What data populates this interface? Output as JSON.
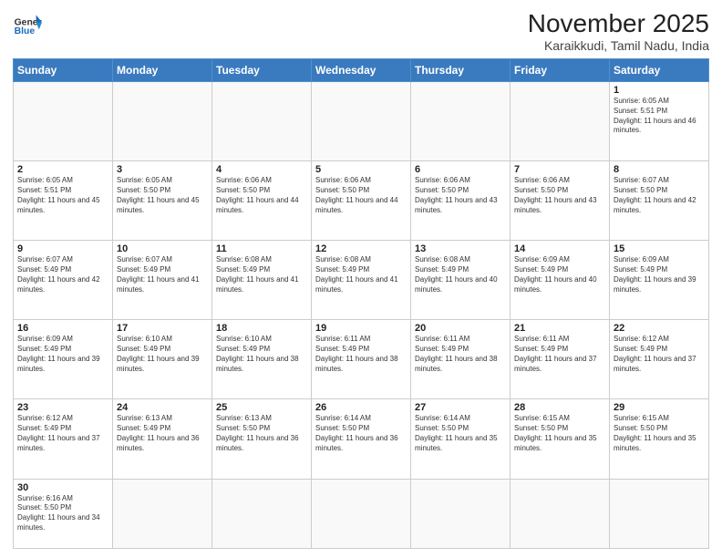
{
  "header": {
    "logo_general": "General",
    "logo_blue": "Blue",
    "title": "November 2025",
    "subtitle": "Karaikkudi, Tamil Nadu, India"
  },
  "days_of_week": [
    "Sunday",
    "Monday",
    "Tuesday",
    "Wednesday",
    "Thursday",
    "Friday",
    "Saturday"
  ],
  "weeks": [
    [
      {
        "day": "",
        "sunrise": "",
        "sunset": "",
        "daylight": ""
      },
      {
        "day": "",
        "sunrise": "",
        "sunset": "",
        "daylight": ""
      },
      {
        "day": "",
        "sunrise": "",
        "sunset": "",
        "daylight": ""
      },
      {
        "day": "",
        "sunrise": "",
        "sunset": "",
        "daylight": ""
      },
      {
        "day": "",
        "sunrise": "",
        "sunset": "",
        "daylight": ""
      },
      {
        "day": "",
        "sunrise": "",
        "sunset": "",
        "daylight": ""
      },
      {
        "day": "1",
        "sunrise": "Sunrise: 6:05 AM",
        "sunset": "Sunset: 5:51 PM",
        "daylight": "Daylight: 11 hours and 46 minutes."
      }
    ],
    [
      {
        "day": "2",
        "sunrise": "Sunrise: 6:05 AM",
        "sunset": "Sunset: 5:51 PM",
        "daylight": "Daylight: 11 hours and 45 minutes."
      },
      {
        "day": "3",
        "sunrise": "Sunrise: 6:05 AM",
        "sunset": "Sunset: 5:50 PM",
        "daylight": "Daylight: 11 hours and 45 minutes."
      },
      {
        "day": "4",
        "sunrise": "Sunrise: 6:06 AM",
        "sunset": "Sunset: 5:50 PM",
        "daylight": "Daylight: 11 hours and 44 minutes."
      },
      {
        "day": "5",
        "sunrise": "Sunrise: 6:06 AM",
        "sunset": "Sunset: 5:50 PM",
        "daylight": "Daylight: 11 hours and 44 minutes."
      },
      {
        "day": "6",
        "sunrise": "Sunrise: 6:06 AM",
        "sunset": "Sunset: 5:50 PM",
        "daylight": "Daylight: 11 hours and 43 minutes."
      },
      {
        "day": "7",
        "sunrise": "Sunrise: 6:06 AM",
        "sunset": "Sunset: 5:50 PM",
        "daylight": "Daylight: 11 hours and 43 minutes."
      },
      {
        "day": "8",
        "sunrise": "Sunrise: 6:07 AM",
        "sunset": "Sunset: 5:50 PM",
        "daylight": "Daylight: 11 hours and 42 minutes."
      }
    ],
    [
      {
        "day": "9",
        "sunrise": "Sunrise: 6:07 AM",
        "sunset": "Sunset: 5:49 PM",
        "daylight": "Daylight: 11 hours and 42 minutes."
      },
      {
        "day": "10",
        "sunrise": "Sunrise: 6:07 AM",
        "sunset": "Sunset: 5:49 PM",
        "daylight": "Daylight: 11 hours and 41 minutes."
      },
      {
        "day": "11",
        "sunrise": "Sunrise: 6:08 AM",
        "sunset": "Sunset: 5:49 PM",
        "daylight": "Daylight: 11 hours and 41 minutes."
      },
      {
        "day": "12",
        "sunrise": "Sunrise: 6:08 AM",
        "sunset": "Sunset: 5:49 PM",
        "daylight": "Daylight: 11 hours and 41 minutes."
      },
      {
        "day": "13",
        "sunrise": "Sunrise: 6:08 AM",
        "sunset": "Sunset: 5:49 PM",
        "daylight": "Daylight: 11 hours and 40 minutes."
      },
      {
        "day": "14",
        "sunrise": "Sunrise: 6:09 AM",
        "sunset": "Sunset: 5:49 PM",
        "daylight": "Daylight: 11 hours and 40 minutes."
      },
      {
        "day": "15",
        "sunrise": "Sunrise: 6:09 AM",
        "sunset": "Sunset: 5:49 PM",
        "daylight": "Daylight: 11 hours and 39 minutes."
      }
    ],
    [
      {
        "day": "16",
        "sunrise": "Sunrise: 6:09 AM",
        "sunset": "Sunset: 5:49 PM",
        "daylight": "Daylight: 11 hours and 39 minutes."
      },
      {
        "day": "17",
        "sunrise": "Sunrise: 6:10 AM",
        "sunset": "Sunset: 5:49 PM",
        "daylight": "Daylight: 11 hours and 39 minutes."
      },
      {
        "day": "18",
        "sunrise": "Sunrise: 6:10 AM",
        "sunset": "Sunset: 5:49 PM",
        "daylight": "Daylight: 11 hours and 38 minutes."
      },
      {
        "day": "19",
        "sunrise": "Sunrise: 6:11 AM",
        "sunset": "Sunset: 5:49 PM",
        "daylight": "Daylight: 11 hours and 38 minutes."
      },
      {
        "day": "20",
        "sunrise": "Sunrise: 6:11 AM",
        "sunset": "Sunset: 5:49 PM",
        "daylight": "Daylight: 11 hours and 38 minutes."
      },
      {
        "day": "21",
        "sunrise": "Sunrise: 6:11 AM",
        "sunset": "Sunset: 5:49 PM",
        "daylight": "Daylight: 11 hours and 37 minutes."
      },
      {
        "day": "22",
        "sunrise": "Sunrise: 6:12 AM",
        "sunset": "Sunset: 5:49 PM",
        "daylight": "Daylight: 11 hours and 37 minutes."
      }
    ],
    [
      {
        "day": "23",
        "sunrise": "Sunrise: 6:12 AM",
        "sunset": "Sunset: 5:49 PM",
        "daylight": "Daylight: 11 hours and 37 minutes."
      },
      {
        "day": "24",
        "sunrise": "Sunrise: 6:13 AM",
        "sunset": "Sunset: 5:49 PM",
        "daylight": "Daylight: 11 hours and 36 minutes."
      },
      {
        "day": "25",
        "sunrise": "Sunrise: 6:13 AM",
        "sunset": "Sunset: 5:50 PM",
        "daylight": "Daylight: 11 hours and 36 minutes."
      },
      {
        "day": "26",
        "sunrise": "Sunrise: 6:14 AM",
        "sunset": "Sunset: 5:50 PM",
        "daylight": "Daylight: 11 hours and 36 minutes."
      },
      {
        "day": "27",
        "sunrise": "Sunrise: 6:14 AM",
        "sunset": "Sunset: 5:50 PM",
        "daylight": "Daylight: 11 hours and 35 minutes."
      },
      {
        "day": "28",
        "sunrise": "Sunrise: 6:15 AM",
        "sunset": "Sunset: 5:50 PM",
        "daylight": "Daylight: 11 hours and 35 minutes."
      },
      {
        "day": "29",
        "sunrise": "Sunrise: 6:15 AM",
        "sunset": "Sunset: 5:50 PM",
        "daylight": "Daylight: 11 hours and 35 minutes."
      }
    ],
    [
      {
        "day": "30",
        "sunrise": "Sunrise: 6:16 AM",
        "sunset": "Sunset: 5:50 PM",
        "daylight": "Daylight: 11 hours and 34 minutes."
      },
      {
        "day": "",
        "sunrise": "",
        "sunset": "",
        "daylight": ""
      },
      {
        "day": "",
        "sunrise": "",
        "sunset": "",
        "daylight": ""
      },
      {
        "day": "",
        "sunrise": "",
        "sunset": "",
        "daylight": ""
      },
      {
        "day": "",
        "sunrise": "",
        "sunset": "",
        "daylight": ""
      },
      {
        "day": "",
        "sunrise": "",
        "sunset": "",
        "daylight": ""
      },
      {
        "day": "",
        "sunrise": "",
        "sunset": "",
        "daylight": ""
      }
    ]
  ]
}
